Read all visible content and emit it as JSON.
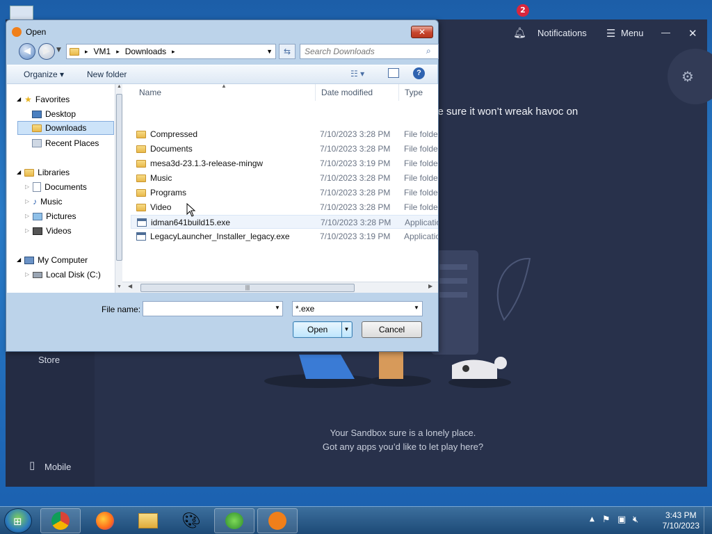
{
  "dialog": {
    "title": "Open",
    "close_glyph": "✕",
    "address": {
      "segments": [
        "VM1",
        "Downloads"
      ],
      "sep": "▸"
    },
    "search_placeholder": "Search Downloads",
    "toolbar": {
      "organize": "Organize ▾",
      "new_folder": "New folder"
    },
    "nav": {
      "favorites": "Favorites",
      "desktop": "Desktop",
      "downloads": "Downloads",
      "recent": "Recent Places",
      "libraries": "Libraries",
      "documents": "Documents",
      "music": "Music",
      "pictures": "Pictures",
      "videos": "Videos",
      "computer": "My Computer",
      "localdisk": "Local Disk (C:)"
    },
    "columns": {
      "name": "Name",
      "date": "Date modified",
      "type": "Type"
    },
    "files": [
      {
        "name": "Compressed",
        "date": "7/10/2023 3:28 PM",
        "type": "File folder",
        "kind": "folder"
      },
      {
        "name": "Documents",
        "date": "7/10/2023 3:28 PM",
        "type": "File folder",
        "kind": "folder"
      },
      {
        "name": "mesa3d-23.1.3-release-mingw",
        "date": "7/10/2023 3:19 PM",
        "type": "File folder",
        "kind": "folder"
      },
      {
        "name": "Music",
        "date": "7/10/2023 3:28 PM",
        "type": "File folder",
        "kind": "folder"
      },
      {
        "name": "Programs",
        "date": "7/10/2023 3:28 PM",
        "type": "File folder",
        "kind": "folder"
      },
      {
        "name": "Video",
        "date": "7/10/2023 3:28 PM",
        "type": "File folder",
        "kind": "folder"
      },
      {
        "name": "idman641build15.exe",
        "date": "7/10/2023 3:28 PM",
        "type": "Application",
        "kind": "exe"
      },
      {
        "name": "LegacyLauncher_Installer_legacy.exe",
        "date": "7/10/2023 3:19 PM",
        "type": "Application",
        "kind": "exe"
      }
    ],
    "filename_label": "File name:",
    "filename_value": "",
    "filter_value": "*.exe",
    "open_label": "Open",
    "cancel_label": "Cancel"
  },
  "avast": {
    "notif_count": "2",
    "notifications": "Notifications",
    "menu": "Menu",
    "minimize": "—",
    "close": "✕",
    "headline": "ke sure it won’t wreak havoc on",
    "store": "Store",
    "mobile": "Mobile",
    "lonely_line1": "Your Sandbox sure is a lonely place.",
    "lonely_line2": "Got any apps you’d like to let play here?"
  },
  "taskbar": {
    "time": "3:43 PM",
    "date": "7/10/2023",
    "apps": [
      "chrome-icon",
      "firefox-icon",
      "explorer-icon",
      "paint-icon",
      "idm-icon",
      "avast-icon"
    ]
  }
}
